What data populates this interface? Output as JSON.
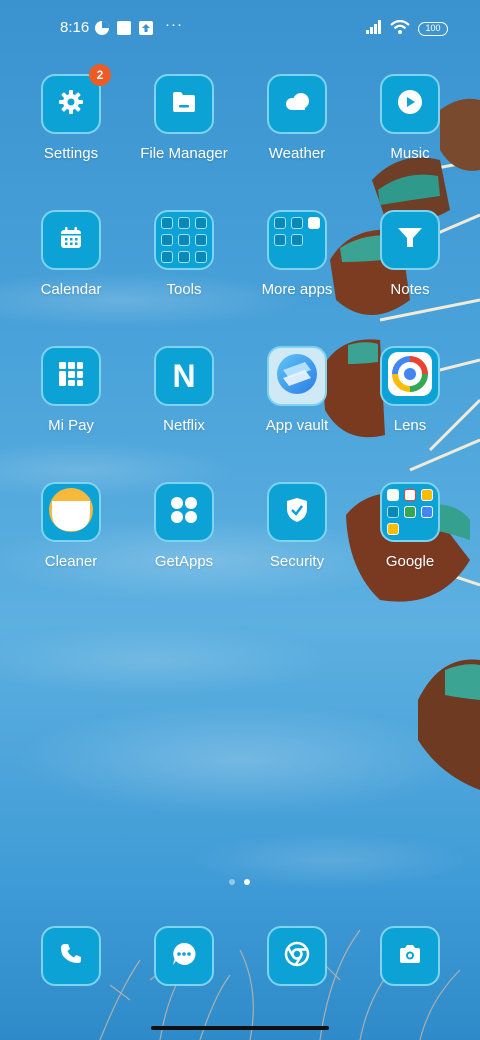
{
  "status_bar": {
    "time": "8:16",
    "battery": "100",
    "more": "···"
  },
  "apps": [
    {
      "label": "Settings",
      "icon": "gear-icon",
      "badge": "2"
    },
    {
      "label": "File Manager",
      "icon": "folder-icon"
    },
    {
      "label": "Weather",
      "icon": "cloud-icon"
    },
    {
      "label": "Music",
      "icon": "play-icon"
    },
    {
      "label": "Calendar",
      "icon": "calendar-icon"
    },
    {
      "label": "Tools",
      "icon": "folder-grid-icon"
    },
    {
      "label": "More apps",
      "icon": "folder-grid-icon"
    },
    {
      "label": "Notes",
      "icon": "notes-icon"
    },
    {
      "label": "Mi Pay",
      "icon": "mipay-icon"
    },
    {
      "label": "Netflix",
      "icon": "netflix-icon",
      "glyph": "N"
    },
    {
      "label": "App vault",
      "icon": "app-vault-icon"
    },
    {
      "label": "Lens",
      "icon": "lens-icon"
    },
    {
      "label": "Cleaner",
      "icon": "cleaner-icon"
    },
    {
      "label": "GetApps",
      "icon": "getapps-icon"
    },
    {
      "label": "Security",
      "icon": "shield-icon"
    },
    {
      "label": "Google",
      "icon": "folder-grid-icon"
    }
  ],
  "dock": [
    {
      "name": "phone",
      "icon": "phone-icon"
    },
    {
      "name": "messages",
      "icon": "message-icon"
    },
    {
      "name": "chrome",
      "icon": "chrome-icon"
    },
    {
      "name": "camera",
      "icon": "camera-icon"
    }
  ],
  "pager": {
    "pages": 2,
    "current": 2
  }
}
